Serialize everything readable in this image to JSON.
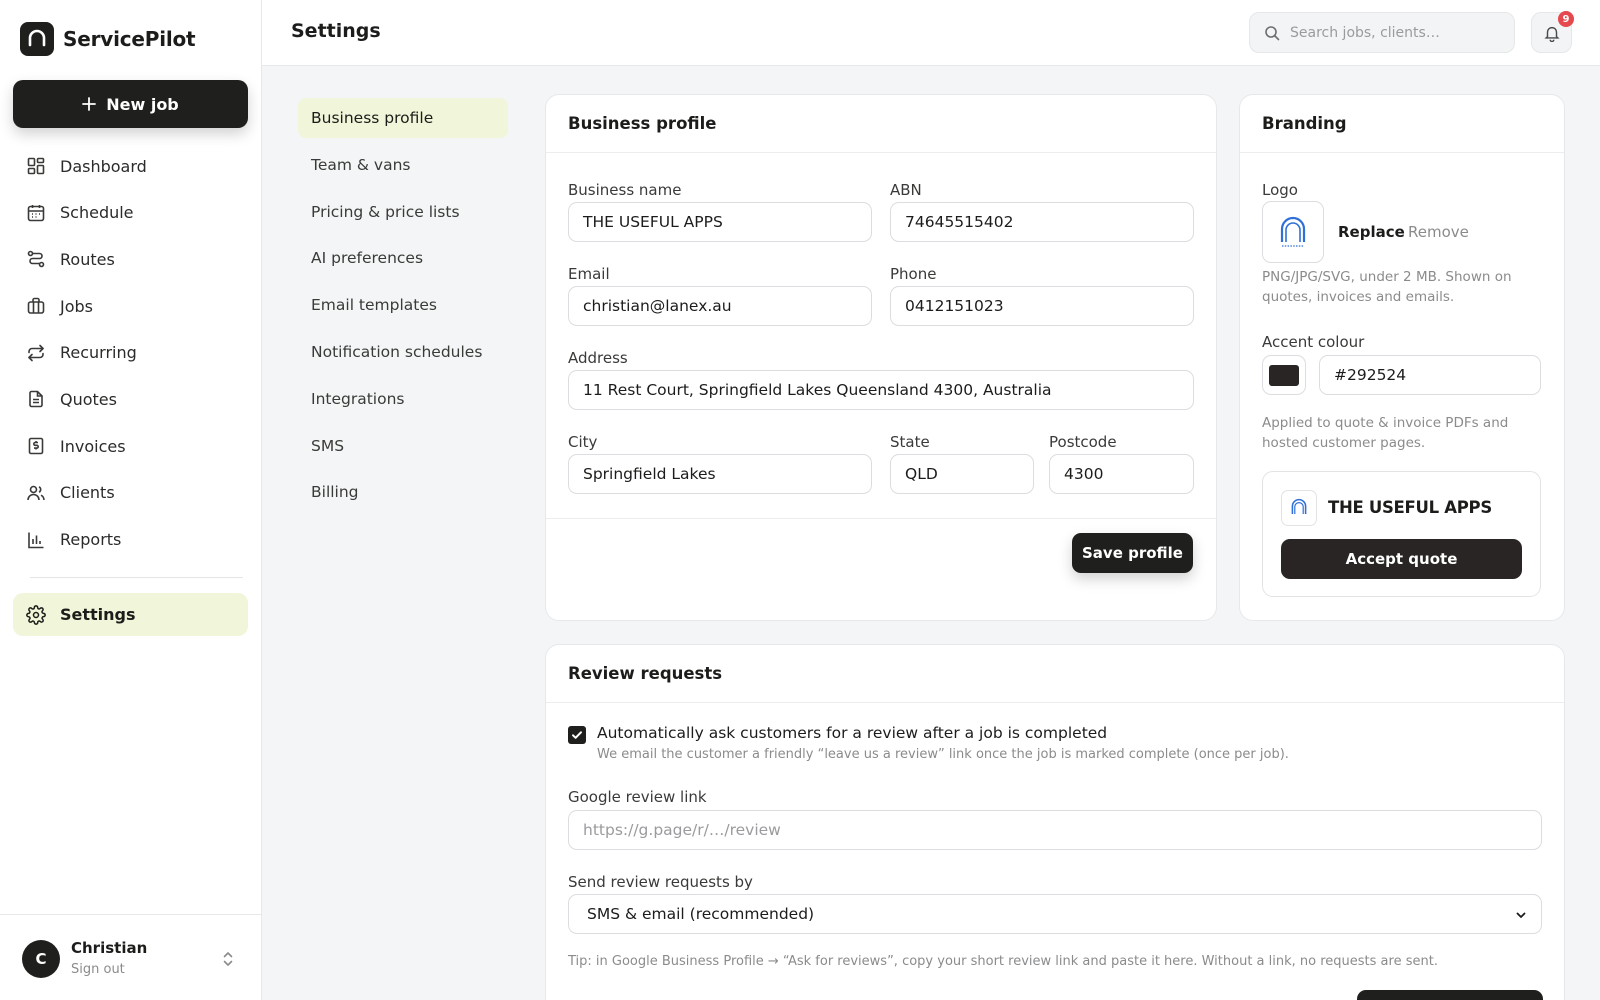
{
  "app": {
    "name": "ServicePilot"
  },
  "sidebar": {
    "new_job_label": "New job",
    "items": [
      {
        "label": "Dashboard",
        "icon": "dashboard-icon"
      },
      {
        "label": "Schedule",
        "icon": "calendar-icon"
      },
      {
        "label": "Routes",
        "icon": "route-icon"
      },
      {
        "label": "Jobs",
        "icon": "briefcase-icon"
      },
      {
        "label": "Recurring",
        "icon": "repeat-icon"
      },
      {
        "label": "Quotes",
        "icon": "document-icon"
      },
      {
        "label": "Invoices",
        "icon": "invoice-icon"
      },
      {
        "label": "Clients",
        "icon": "users-icon"
      },
      {
        "label": "Reports",
        "icon": "bar-chart-icon"
      }
    ],
    "settings_label": "Settings"
  },
  "user": {
    "initial": "C",
    "name": "Christian",
    "action": "Sign out"
  },
  "header": {
    "title": "Settings",
    "search_placeholder": "Search jobs, clients…",
    "notification_count": "9"
  },
  "settings_nav": {
    "items": [
      "Business profile",
      "Team & vans",
      "Pricing & price lists",
      "AI preferences",
      "Email templates",
      "Notification schedules",
      "Integrations",
      "SMS",
      "Billing"
    ],
    "active": "Business profile"
  },
  "business_profile": {
    "title": "Business profile",
    "business_name": {
      "label": "Business name",
      "value": "THE USEFUL APPS"
    },
    "abn": {
      "label": "ABN",
      "value": "74645515402"
    },
    "email": {
      "label": "Email",
      "value": "christian@lanex.au"
    },
    "phone": {
      "label": "Phone",
      "value": "0412151023"
    },
    "address": {
      "label": "Address",
      "value": "11 Rest Court, Springfield Lakes Queensland 4300, Australia"
    },
    "city": {
      "label": "City",
      "value": "Springfield Lakes"
    },
    "state": {
      "label": "State",
      "value": "QLD"
    },
    "postcode": {
      "label": "Postcode",
      "value": "4300"
    },
    "save_label": "Save profile"
  },
  "branding": {
    "title": "Branding",
    "logo_label": "Logo",
    "replace_label": "Replace",
    "remove_label": "Remove",
    "logo_hint": "PNG/JPG/SVG, under 2 MB. Shown on quotes, invoices and emails.",
    "accent_label": "Accent colour",
    "accent_value": "#292524",
    "accent_hint": "Applied to quote & invoice PDFs and hosted customer pages.",
    "preview_name": "THE USEFUL APPS",
    "preview_button": "Accept quote",
    "logo_text": "USEFUL APPS"
  },
  "review_requests": {
    "title": "Review requests",
    "auto_ask_label": "Automatically ask customers for a review after a job is completed",
    "auto_ask_checked": true,
    "auto_ask_hint": "We email the customer a friendly “leave us a review” link once the job is marked complete (once per job).",
    "google_link_label": "Google review link",
    "google_link_placeholder": "https://g.page/r/…/review",
    "send_by_label": "Send review requests by",
    "send_by_value": "SMS & email (recommended)",
    "tip": "Tip: in Google Business Profile → “Ask for reviews”, copy your short review link and paste it here. Without a link, no requests are sent."
  },
  "colors": {
    "accent": "#292524",
    "active_bg": "#f1f5d9",
    "logo_blue": "#2f6fd6",
    "badge": "#e5484d"
  }
}
